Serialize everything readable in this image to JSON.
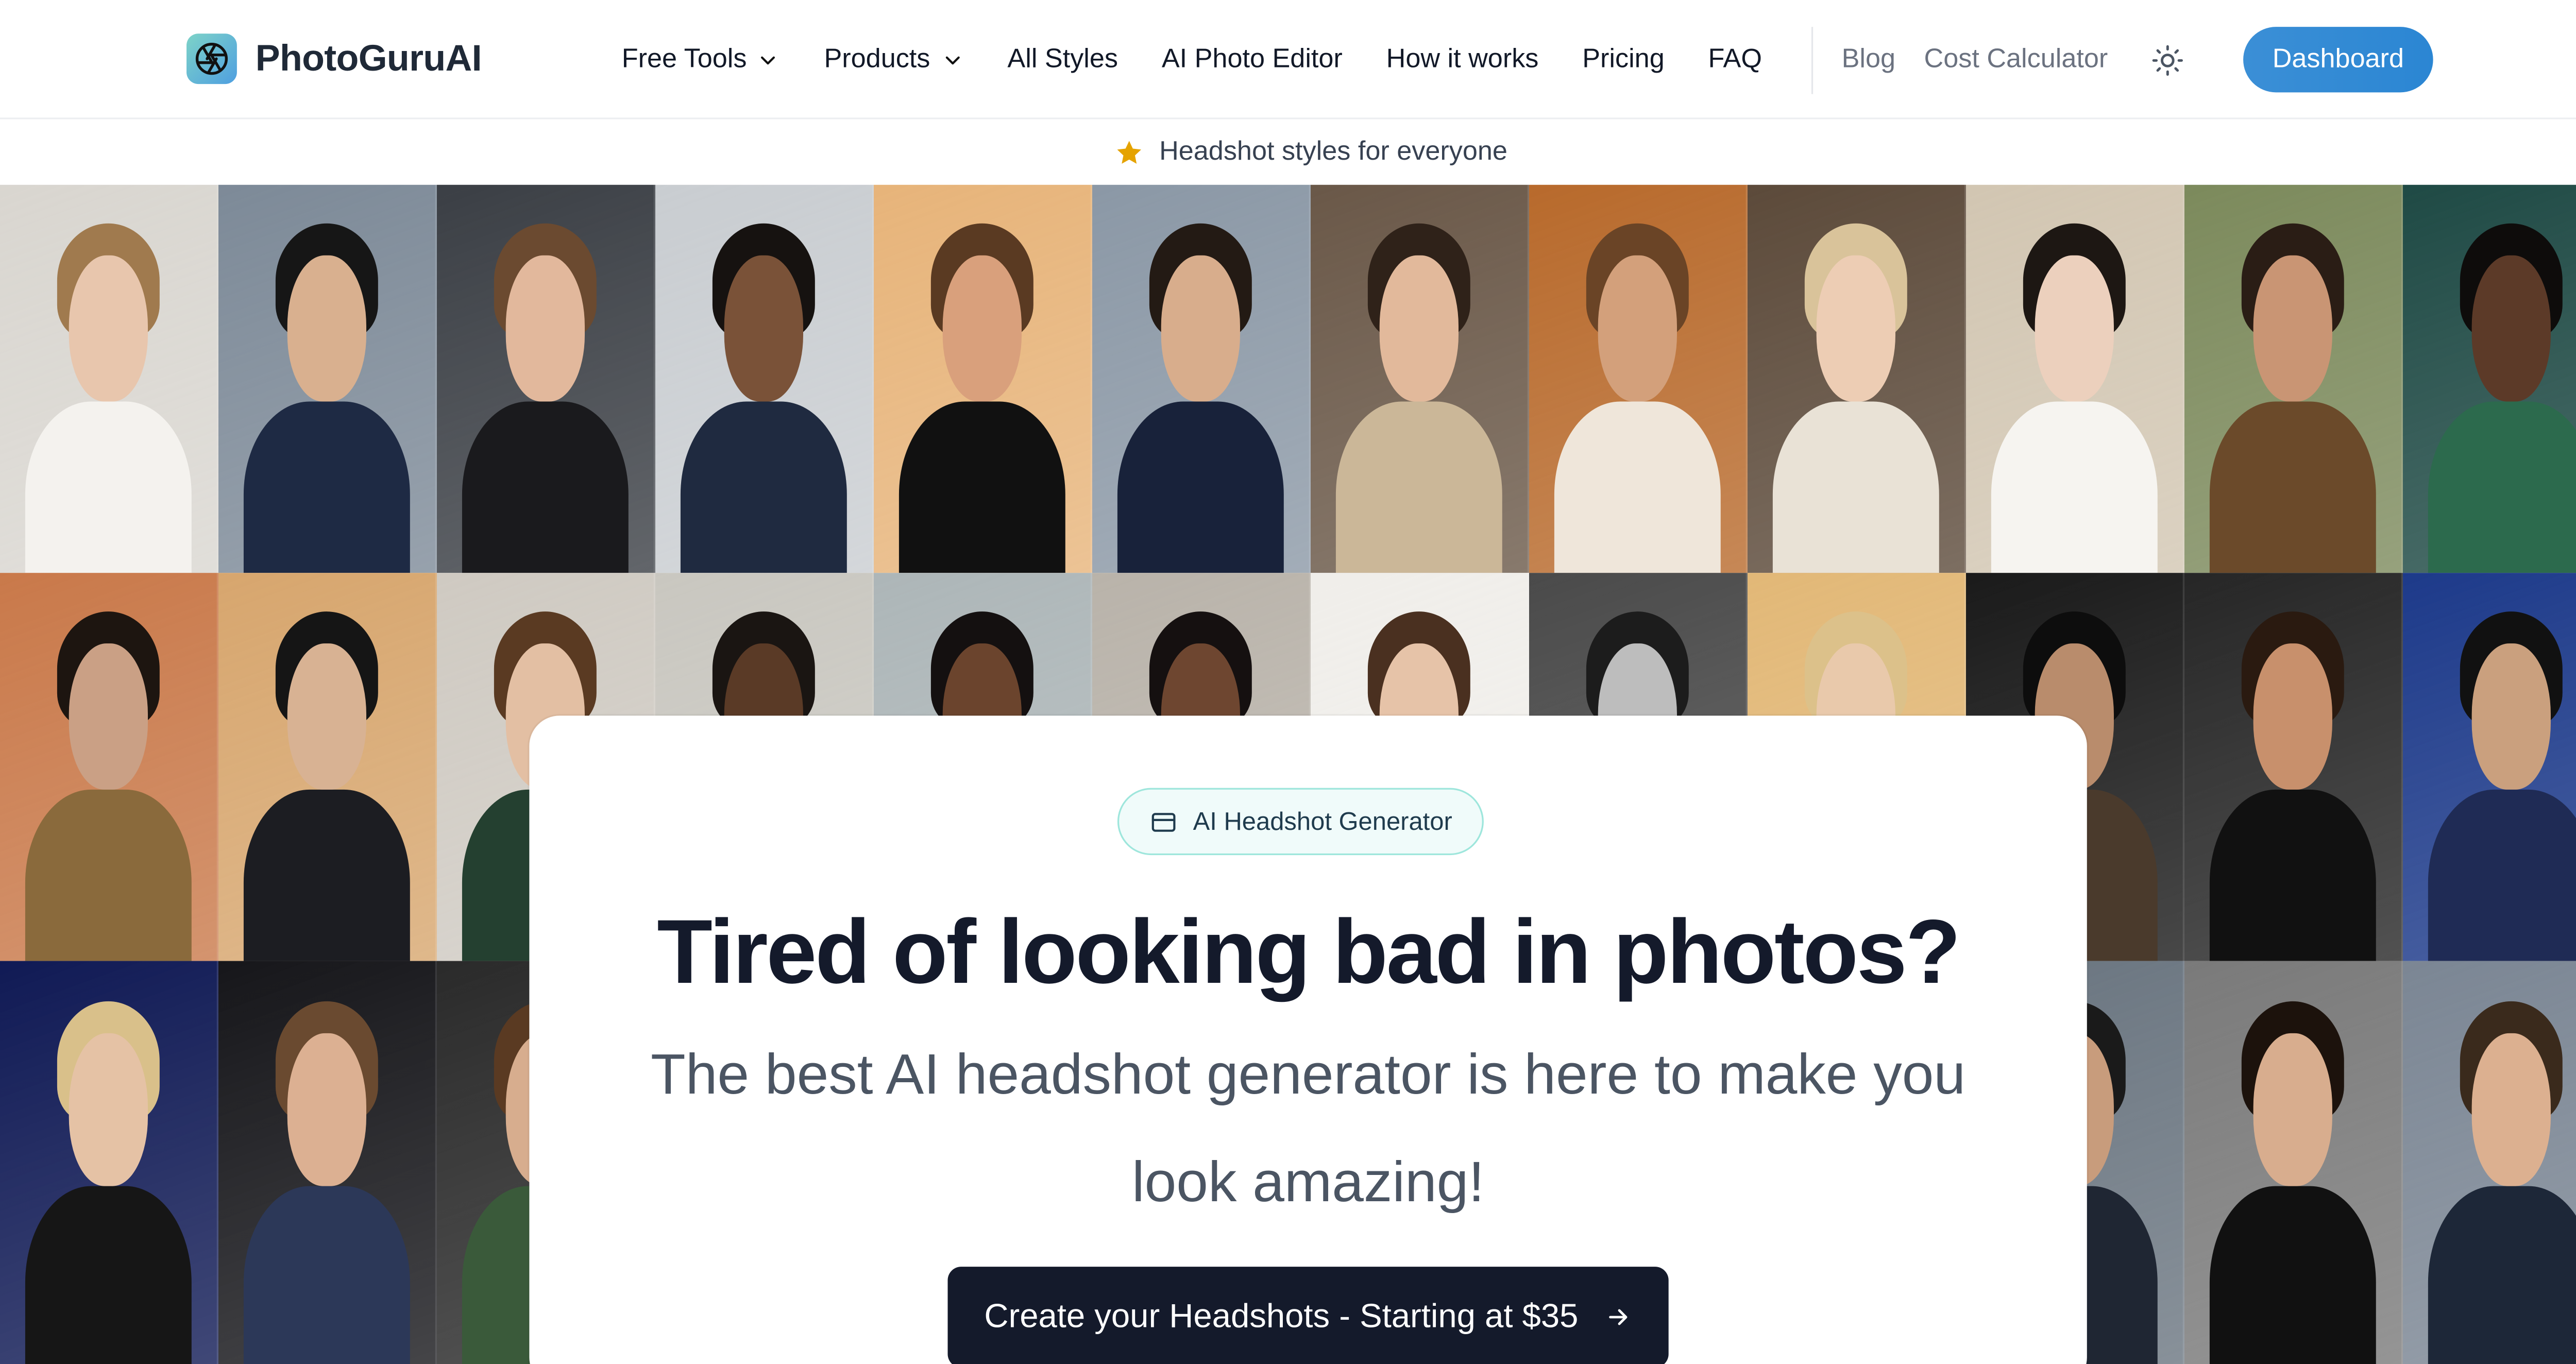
{
  "header": {
    "logo_text": "PhotoGuruAI",
    "nav": [
      {
        "label": "Free Tools",
        "has_dropdown": true
      },
      {
        "label": "Products",
        "has_dropdown": true
      },
      {
        "label": "All Styles"
      },
      {
        "label": "AI Photo Editor"
      },
      {
        "label": "How it works"
      },
      {
        "label": "Pricing"
      },
      {
        "label": "FAQ"
      }
    ],
    "secondary_nav": [
      {
        "label": "Blog"
      },
      {
        "label": "Cost Calculator"
      }
    ],
    "theme_icon": "sun-icon",
    "dashboard_label": "Dashboard",
    "accent_color": "#2b86d3"
  },
  "banner": {
    "icon": "star-icon",
    "text": "Headshot styles for everyone",
    "icon_color": "#e5a300"
  },
  "hero": {
    "badge_icon": "card-icon",
    "badge_label": "AI Headshot Generator",
    "title": "Tired of looking bad in photos?",
    "subtitle": "The best AI headshot generator is here to make you look amazing!",
    "cta_label": "Create your Headshots - Starting at $35",
    "cta_icon": "arrow-right-icon",
    "cta_color": "#141a2b"
  },
  "gallery": {
    "photos": [
      {
        "bg": "#d9d6d0",
        "hair": "#a07a4e",
        "skin": "#e8c6ad",
        "body": "#f4f2ee"
      },
      {
        "bg": "#7d8a98",
        "hair": "#161616",
        "skin": "#d9b08f",
        "body": "#1e2a44"
      },
      {
        "bg": "#3b3f45",
        "hair": "#6b4a30",
        "skin": "#e2b89c",
        "body": "#1a1a1d"
      },
      {
        "bg": "#c9cdd1",
        "hair": "#161210",
        "skin": "#7a5238",
        "body": "#1f2a40"
      },
      {
        "bg": "#e7b47a",
        "hair": "#5a3a22",
        "skin": "#d9a07c",
        "body": "#111111"
      },
      {
        "bg": "#8b98a6",
        "hair": "#231a14",
        "skin": "#d8ad8c",
        "body": "#18223a"
      },
      {
        "bg": "#6a5848",
        "hair": "#2f2219",
        "skin": "#e2b99b",
        "body": "#cbb798"
      },
      {
        "bg": "#b86a2c",
        "hair": "#6a4426",
        "skin": "#d3a07b",
        "body": "#efe6da"
      },
      {
        "bg": "#5c4a3a",
        "hair": "#d9c39a",
        "skin": "#edcdb4",
        "body": "#e9e2d6"
      },
      {
        "bg": "#d2c6b2",
        "hair": "#1d1713",
        "skin": "#ecd0bd",
        "body": "#f6f4f0"
      },
      {
        "bg": "#7c8a5c",
        "hair": "#2a1d15",
        "skin": "#c99574",
        "body": "#6b4a2a"
      },
      {
        "bg": "#1f4a45",
        "hair": "#0e0c0b",
        "skin": "#5c3a28",
        "body": "#2c6a4d"
      },
      {
        "bg": "#c9794a",
        "hair": "#1d1510",
        "skin": "#caa085",
        "body": "#8a6a3c"
      },
      {
        "bg": "#d7a66e",
        "hair": "#151515",
        "skin": "#d8b293",
        "body": "#1c1d22"
      },
      {
        "bg": "#cfcac2",
        "hair": "#5a3a22",
        "skin": "#e3bfa3",
        "body": "#244030"
      },
      {
        "bg": "#c9c7c0",
        "hair": "#1a1512",
        "skin": "#5a3a26",
        "body": "#2a2a2a"
      },
      {
        "bg": "#adb6b8",
        "hair": "#141010",
        "skin": "#6b442d",
        "body": "#2e2e2e"
      },
      {
        "bg": "#b9b3aa",
        "hair": "#151010",
        "skin": "#6e4630",
        "body": "#3a3a3a"
      },
      {
        "bg": "#f0eeea",
        "hair": "#4a3020",
        "skin": "#e6c3a8",
        "body": "#ffffff"
      },
      {
        "bg": "#4a4a4a",
        "hair": "#1c1c1c",
        "skin": "#bdbdbd",
        "body": "#222222"
      },
      {
        "bg": "#e2b877",
        "hair": "#dcc18a",
        "skin": "#e9c9ab",
        "body": "#c9a576"
      },
      {
        "bg": "#1a1a1a",
        "hair": "#0d0d0d",
        "skin": "#b98c6c",
        "body": "#4a3a2c"
      },
      {
        "bg": "#262626",
        "hair": "#2a1a10",
        "skin": "#c8906c",
        "body": "#111111"
      },
      {
        "bg": "#1d3a8a",
        "hair": "#111111",
        "skin": "#caa07e",
        "body": "#1f2b55"
      },
      {
        "bg": "#101a55",
        "hair": "#d9c08a",
        "skin": "#e5c2a5",
        "body": "#161616"
      },
      {
        "bg": "#16161a",
        "hair": "#6a4a30",
        "skin": "#dcb092",
        "body": "#2c3858"
      },
      {
        "bg": "#2a2a2a",
        "hair": "#5a3a22",
        "skin": "#d7ad8e",
        "body": "#3a5a3a"
      },
      {
        "bg": "#555555",
        "hair": "#222222",
        "skin": "#c9a080",
        "body": "#333333"
      },
      {
        "bg": "#555555",
        "hair": "#222222",
        "skin": "#c9a080",
        "body": "#333333"
      },
      {
        "bg": "#555555",
        "hair": "#222222",
        "skin": "#c9a080",
        "body": "#333333"
      },
      {
        "bg": "#555555",
        "hair": "#222222",
        "skin": "#c9a080",
        "body": "#333333"
      },
      {
        "bg": "#555555",
        "hair": "#222222",
        "skin": "#c9a080",
        "body": "#333333"
      },
      {
        "bg": "#555555",
        "hair": "#222222",
        "skin": "#c9a080",
        "body": "#333333"
      },
      {
        "bg": "#6a7580",
        "hair": "#1a1a1a",
        "skin": "#c89c7c",
        "body": "#1f2633"
      },
      {
        "bg": "#7a7a7a",
        "hair": "#1c120c",
        "skin": "#d8ad8e",
        "body": "#111111"
      },
      {
        "bg": "#7b8694",
        "hair": "#3a2a1c",
        "skin": "#dcb090",
        "body": "#1d2738"
      }
    ]
  }
}
